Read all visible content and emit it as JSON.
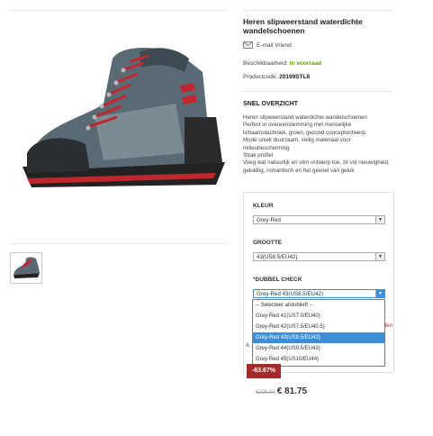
{
  "product": {
    "title": "Heren slipweerstand waterdichte wandelschoenen",
    "email_link": "E-mail Vriend",
    "availability_label": "Beschikbaarheid:",
    "availability_value": "In voorraad",
    "code_label": "Productcode:",
    "code_value": "20199STL8"
  },
  "overview": {
    "heading": "SNEL OVERZICHT",
    "lines": [
      "Heren slipweerstand waterdichte wandelschoenen",
      "Perfect in overeenstemming met menselijke",
      "lichaamstechniek, groen, gezond conceptontwerp.",
      "Mode uniek duurzaam, veilig materiaal voor",
      "milieubescherming",
      "Strak profiel",
      "Voeg wat natuurlijk en slim ontwerp toe, zit vol nieuwigheid,",
      "gelukkig, romantisch en het gevoel van geluk"
    ]
  },
  "options": {
    "color_label": "KLEUR",
    "color_value": "Grey-Red",
    "size_label": "GROOTTE",
    "size_value": "43(US8.5/EU42)",
    "check_label": "DUBBEL CHECK",
    "check_required": "*",
    "check_value": "Grey-Red 43(US8.5/EU42)",
    "dropdown": [
      "-- Selecteer alstublieft --",
      "Grey-Red 41(US7.0/EU40)",
      "Grey-Red 42(US7.5/EU40.5)",
      "Grey-Red 43(US8.5/EU42)",
      "Grey-Red 44(US9.5/EU43)",
      "Grey-Red 45(US10/EU44)"
    ],
    "selected_index": 3,
    "partial_right": "den",
    "partial_left": "A"
  },
  "pricing": {
    "discount": "-63.67%",
    "old_price": "€225.00",
    "new_price": "€ 81.75"
  },
  "colors": {
    "accent": "#3d8ed6",
    "in_stock": "#5aa000",
    "discount_bg": "#a52a2a"
  },
  "icons": [
    "email-icon",
    "shoe-image",
    "dropdown-arrow-icon"
  ]
}
